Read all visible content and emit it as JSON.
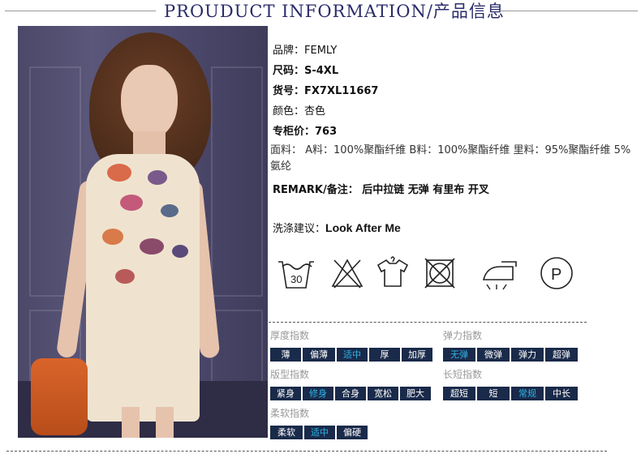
{
  "header": {
    "title": "PROUDUCT INFORMATION/产品信息"
  },
  "specs": {
    "brand": "品牌：FEMLY",
    "size": "尺码：S-4XL",
    "item_no": "货号：FX7XL11667",
    "color": "颜色：杏色",
    "price": "专柜价：763",
    "material": "面料： A料：100%聚酯纤维 B料：100%聚酯纤维 里料：95%聚酯纤维 5%氨纶",
    "remark": "REMARK/备注： 后中拉链 无弹 有里布 开叉",
    "wash_label": "洗涤建议：",
    "wash_value": "Look After Me"
  },
  "care_icons": [
    {
      "icon": "wash-30-icon",
      "text": "30"
    },
    {
      "icon": "no-bleach-icon"
    },
    {
      "icon": "hang-dry-icon"
    },
    {
      "icon": "no-tumble-dry-icon"
    },
    {
      "icon": "iron-low-icon"
    },
    {
      "icon": "dry-clean-p-icon",
      "text": "P"
    }
  ],
  "attributes": {
    "thickness": {
      "label": "厚度指数",
      "options": [
        "薄",
        "偏薄",
        "适中",
        "厚",
        "加厚"
      ],
      "selected": "适中"
    },
    "elasticity": {
      "label": "弹力指数",
      "options": [
        "无弹",
        "微弹",
        "弹力",
        "超弹"
      ],
      "selected": "无弹"
    },
    "fit": {
      "label": "版型指数",
      "options": [
        "紧身",
        "修身",
        "合身",
        "宽松",
        "肥大"
      ],
      "selected": "修身"
    },
    "length": {
      "label": "长短指数",
      "options": [
        "超短",
        "短",
        "常规",
        "中长"
      ],
      "selected": "常规"
    },
    "softness": {
      "label": "柔软指数",
      "options": [
        "柔软",
        "适中",
        "偏硬"
      ],
      "selected": "适中"
    }
  },
  "colors": {
    "option_bg": "#1a2a4a",
    "option_selected_text": "#2ab7ea",
    "header_title": "#2b2b6b"
  }
}
